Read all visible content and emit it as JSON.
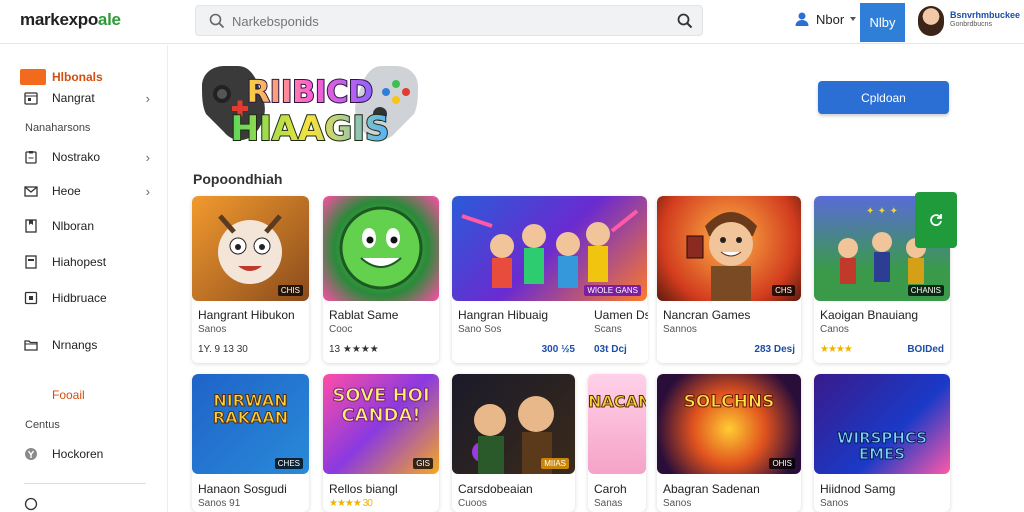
{
  "header": {
    "logo_main": "markexpo",
    "logo_accent": "ale",
    "search_placeholder": "Narkebsponids",
    "account_label": "Nbor",
    "top_button": "Nlby",
    "brand_title": "Bsnvrhmbuckee",
    "brand_sub": "Gonbrdbucns"
  },
  "sidebar": {
    "active_label": "Hlbonals",
    "items": [
      {
        "label": "Nangrat",
        "icon": "calendar-icon",
        "chevron": true
      },
      {
        "label": "Nostrako",
        "icon": "clipboard-icon",
        "chevron": true
      },
      {
        "label": "Heoe",
        "icon": "mail-icon",
        "chevron": true
      },
      {
        "label": "Nlboran",
        "icon": "bookmark-icon",
        "chevron": false
      },
      {
        "label": "Hiahopest",
        "icon": "document-icon",
        "chevron": false
      },
      {
        "label": "Hidbruace",
        "icon": "square-icon",
        "chevron": false
      },
      {
        "label": "Nrnangs",
        "icon": "folder-icon",
        "chevron": false
      },
      {
        "label": "Hockoren",
        "icon": "circle-y-icon",
        "chevron": false
      }
    ],
    "heading_1": "Nanaharsons",
    "orange_label": "Fooail",
    "heading_2": "Centus"
  },
  "hero": {
    "logo_line1": "RIIBICD",
    "logo_line2": "HIAAGIS",
    "cta_label": "Cpldoan"
  },
  "section_title": "Popoondhiah",
  "row1": [
    {
      "title": "Hangrant Hibukon",
      "sub": "Sanos",
      "meta_left": "1Y. 9 13 30",
      "meta_right": "",
      "tag": "CHIS"
    },
    {
      "title": "Rablat Same",
      "sub": "Cooc",
      "meta_left": "13 ★★★★",
      "meta_right": "",
      "tag": ""
    },
    {
      "title": "Hangran Hibuaig",
      "sub": "Sano Sos",
      "meta_left": "",
      "meta_right": "300  ½5",
      "tag": "WIOLE GANS"
    },
    {
      "title": "Uamen Ds",
      "sub": "Scans",
      "meta_left": "",
      "meta_right": "03t Dcj",
      "tag": ""
    },
    {
      "title": "Nancran Games",
      "sub": "Sannos",
      "meta_left": "",
      "meta_right": "283 Desj",
      "tag": "CHS"
    },
    {
      "title": "Kaoigan Bnauiang",
      "sub": "Canos",
      "meta_left": "★★★★",
      "meta_right": "BOIDed",
      "tag": "CHANIS"
    }
  ],
  "row2": [
    {
      "title": "Hanaon Sosgudi",
      "sub": "Sanos 91",
      "tag": "CHES",
      "art_text": "NIRWAN RAKAAN"
    },
    {
      "title": "Rellos biangl",
      "sub": "★★★★ 30",
      "tag": "GIS",
      "art_text": "SOVE HOI CANDA!"
    },
    {
      "title": "Carsdobeaian",
      "sub": "Cuoos",
      "tag": "MIIAS",
      "art_text": ""
    },
    {
      "title": "Caroh",
      "sub": "Sanas",
      "tag": "",
      "art_text": "NACAN"
    },
    {
      "title": "Abagran Sadenan",
      "sub": "Sanos",
      "tag": "OHIS",
      "art_text": "SOLCHNS"
    },
    {
      "title": "Hiidnod Samg",
      "sub": "Sanos",
      "tag": "",
      "art_text": "WIRSPHCS EMES"
    }
  ],
  "colors": {
    "accent_blue": "#2c6fd4",
    "accent_orange": "#f26b1d",
    "star": "#f0b400",
    "rating_blue": "#1d4da8"
  }
}
